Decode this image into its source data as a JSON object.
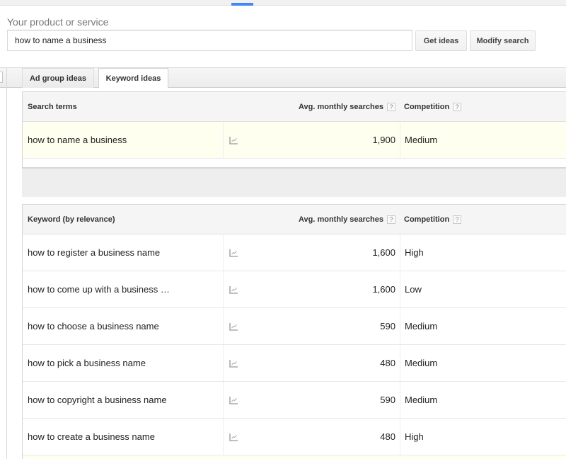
{
  "header": {
    "product_label": "Your product or service",
    "search_value": "how to name a business",
    "get_ideas_label": "Get ideas",
    "modify_search_label": "Modify search",
    "accent_color": "#4285f4"
  },
  "tabs": [
    {
      "label": "Ad group ideas",
      "active": false
    },
    {
      "label": "Keyword ideas",
      "active": true
    }
  ],
  "search_terms_table": {
    "columns": {
      "term": "Search terms",
      "avg": "Avg. monthly searches",
      "competition": "Competition",
      "help": "?"
    },
    "rows": [
      {
        "term": "how to name a business",
        "avg": "1,900",
        "competition": "Medium",
        "trend_icon": "line-chart-icon"
      }
    ]
  },
  "keyword_table": {
    "columns": {
      "term": "Keyword (by relevance)",
      "avg": "Avg. monthly searches",
      "competition": "Competition",
      "help": "?"
    },
    "rows": [
      {
        "term": "how to register a business name",
        "avg": "1,600",
        "competition": "High"
      },
      {
        "term": "how to come up with a business …",
        "avg": "1,600",
        "competition": "Low"
      },
      {
        "term": "how to choose a business name",
        "avg": "590",
        "competition": "Medium"
      },
      {
        "term": "how to pick a business name",
        "avg": "480",
        "competition": "Medium"
      },
      {
        "term": "how to copyright a business name",
        "avg": "590",
        "competition": "Medium"
      },
      {
        "term": "how to create a business name",
        "avg": "480",
        "competition": "High"
      }
    ]
  }
}
